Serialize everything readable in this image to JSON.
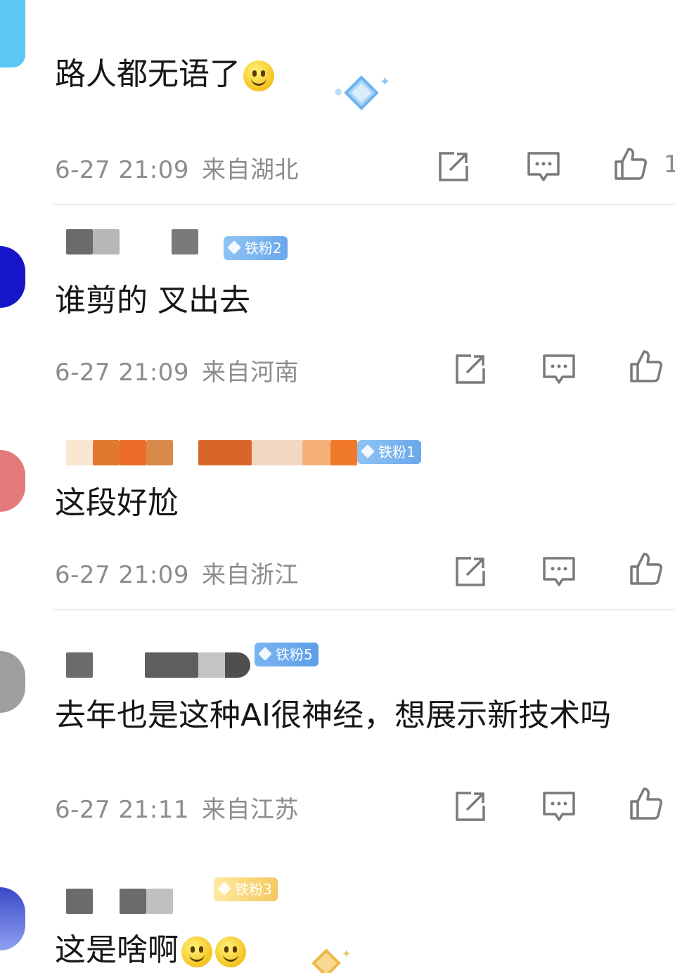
{
  "colors": {
    "meta_text": "#8c8c8c",
    "badge_blue": "#7bb6f0",
    "divider": "#ececec"
  },
  "comments": [
    {
      "text": "路人都无语了",
      "emoji": "smile-emoji",
      "time": "6-27 21:09",
      "location": "来自湖北",
      "like_count": "1"
    },
    {
      "badge": "铁粉2",
      "text": "谁剪的 叉出去",
      "time": "6-27 21:09",
      "location": "来自河南"
    },
    {
      "badge": "铁粉1",
      "text": "这段好尬",
      "time": "6-27 21:09",
      "location": "来自浙江"
    },
    {
      "badge": "铁粉5",
      "text": "去年也是这种AI很神经，想展示新技术吗",
      "time": "6-27 21:11",
      "location": "来自江苏"
    },
    {
      "badge": "铁粉3",
      "text": "这是啥啊",
      "emoji": "laugh-cry-emoji"
    }
  ],
  "icons": {
    "share": "share-icon",
    "comment": "comment-icon",
    "like": "thumbs-up-icon"
  }
}
